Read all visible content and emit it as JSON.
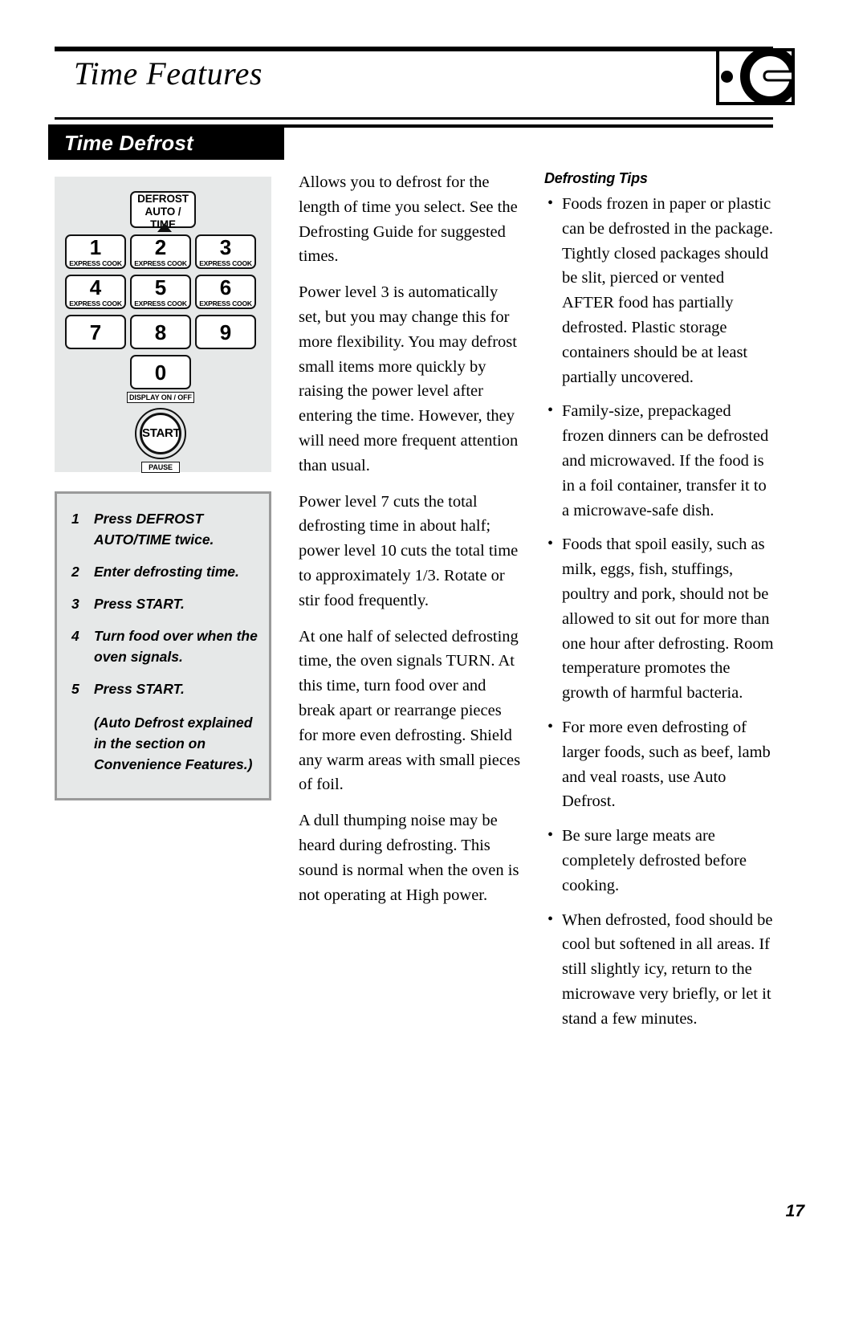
{
  "header": {
    "title": "Time Features",
    "logo_name": "ge-monogram-logo"
  },
  "section": {
    "banner_label": "Time Defrost"
  },
  "keypad": {
    "defrost_key": {
      "line1": "DEFROST",
      "line2": "AUTO / TIME"
    },
    "keys": [
      {
        "digit": "1",
        "sub": "EXPRESS COOK"
      },
      {
        "digit": "2",
        "sub": "EXPRESS COOK"
      },
      {
        "digit": "3",
        "sub": "EXPRESS COOK"
      },
      {
        "digit": "4",
        "sub": "EXPRESS COOK"
      },
      {
        "digit": "5",
        "sub": "EXPRESS COOK"
      },
      {
        "digit": "6",
        "sub": "EXPRESS COOK"
      },
      {
        "digit": "7",
        "sub": ""
      },
      {
        "digit": "8",
        "sub": ""
      },
      {
        "digit": "9",
        "sub": ""
      }
    ],
    "zero_key": {
      "digit": "0"
    },
    "display_label": "DISPLAY ON / OFF",
    "start_label": "START",
    "pause_label": "PAUSE"
  },
  "steps": [
    {
      "num": "1",
      "text": "Press DEFROST AUTO/TIME twice."
    },
    {
      "num": "2",
      "text": "Enter defrosting time."
    },
    {
      "num": "3",
      "text": "Press START."
    },
    {
      "num": "4",
      "text": "Turn food over when the oven signals."
    },
    {
      "num": "5",
      "text": "Press START."
    }
  ],
  "steps_note": "(Auto Defrost explained in the section on Convenience Features.)",
  "body_paragraphs": [
    "Allows you to defrost for the length of time you select. See the Defrosting Guide for suggested times.",
    "Power level 3 is automatically set, but you may change this for more flexibility. You may defrost small items more quickly by raising the power level after entering the time. However, they will need more frequent attention than usual.",
    "Power level 7 cuts the total defrosting time in about half; power level 10 cuts the total time to approximately 1/3. Rotate or stir food frequently.",
    "At one half of selected defrosting time, the oven signals TURN. At this time, turn food over and break apart or rearrange pieces for more even defrosting. Shield any warm areas with small pieces of foil.",
    "A dull thumping noise may be heard during defrosting. This sound is normal when the oven is not operating at High power."
  ],
  "tips": {
    "title": "Defrosting Tips",
    "bullet_glyph": "•",
    "items": [
      "Foods frozen in paper or plastic can be defrosted in the package. Tightly closed packages should be slit, pierced or vented AFTER food has partially defrosted. Plastic storage containers should be at least partially uncovered.",
      "Family-size, prepackaged frozen dinners can be defrosted and microwaved. If the food is in a foil container, transfer it to a microwave-safe dish.",
      "Foods that spoil easily, such as milk, eggs, fish, stuffings, poultry and pork, should not be allowed to sit out for more than one hour after defrosting. Room temperature promotes the growth of harmful bacteria.",
      "For more even defrosting of larger foods, such as beef, lamb and veal roasts, use Auto Defrost.",
      "Be sure large meats are completely defrosted before cooking.",
      "When defrosted, food should be cool but softened in all areas. If still slightly icy, return to the microwave very briefly, or let it stand a few minutes."
    ]
  },
  "footer": {
    "page_number": "17"
  },
  "colors": {
    "ink": "#000000",
    "panel_gray": "#e6e8e8",
    "panel_border_gray": "#9a9a9a",
    "paper": "#ffffff"
  }
}
